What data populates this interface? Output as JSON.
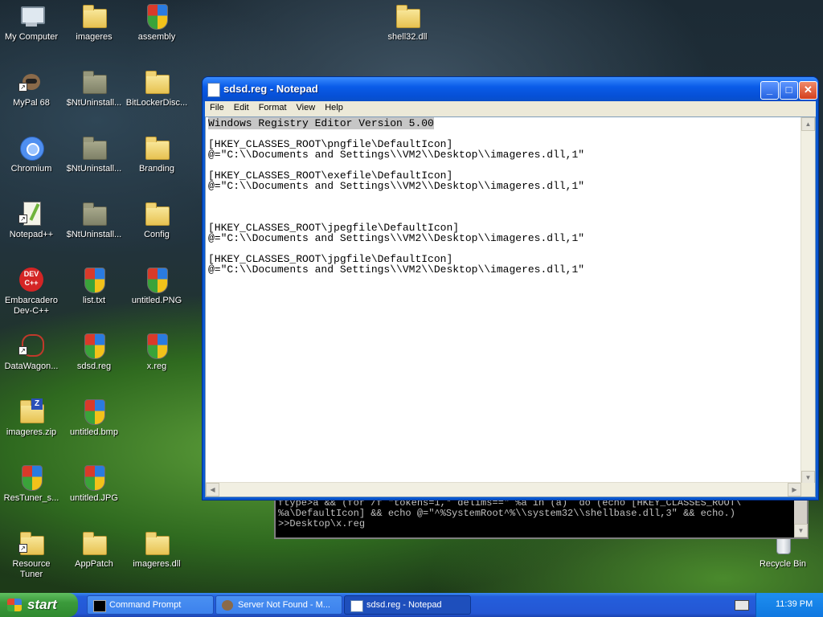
{
  "desktop": {
    "icons": [
      {
        "label": "My Computer",
        "type": "computer"
      },
      {
        "label": "imageres",
        "type": "folder"
      },
      {
        "label": "assembly",
        "type": "shield"
      },
      {
        "label": "shell32.dll",
        "type": "folder"
      },
      {
        "label": "MyPal 68",
        "type": "app"
      },
      {
        "label": "$NtUninstall...",
        "type": "folder-gray"
      },
      {
        "label": "BitLockerDisc...",
        "type": "folder"
      },
      {
        "label": "Chromium",
        "type": "app"
      },
      {
        "label": "$NtUninstall...",
        "type": "folder-gray"
      },
      {
        "label": "Branding",
        "type": "folder"
      },
      {
        "label": "Notepad++",
        "type": "app"
      },
      {
        "label": "$NtUninstall...",
        "type": "folder-gray"
      },
      {
        "label": "Config",
        "type": "folder"
      },
      {
        "label": "Embarcadero Dev-C++",
        "type": "app"
      },
      {
        "label": "list.txt",
        "type": "shield"
      },
      {
        "label": "untitled.PNG",
        "type": "shield"
      },
      {
        "label": "DataWagon...",
        "type": "app"
      },
      {
        "label": "sdsd.reg",
        "type": "shield"
      },
      {
        "label": "x.reg",
        "type": "shield"
      },
      {
        "label": "imageres.zip",
        "type": "zip"
      },
      {
        "label": "untitled.bmp",
        "type": "shield"
      },
      {
        "label": "ResTuner_s...",
        "type": "shield"
      },
      {
        "label": "untitled.JPG",
        "type": "shield"
      },
      {
        "label": "Resource Tuner",
        "type": "folder"
      },
      {
        "label": "AppPatch",
        "type": "folder"
      },
      {
        "label": "imageres.dll",
        "type": "folder"
      },
      {
        "label": "Recycle Bin",
        "type": "recycle"
      }
    ]
  },
  "notepad": {
    "title": "sdsd.reg - Notepad",
    "menu": [
      "File",
      "Edit",
      "Format",
      "View",
      "Help"
    ],
    "content_selected": "Windows Registry Editor Version 5.00",
    "content_rest": "\n\n[HKEY_CLASSES_ROOT\\pngfile\\DefaultIcon]\n@=\"C:\\\\Documents and Settings\\\\VM2\\\\Desktop\\\\imageres.dll,1\"\n\n[HKEY_CLASSES_ROOT\\exefile\\DefaultIcon]\n@=\"C:\\\\Documents and Settings\\\\VM2\\\\Desktop\\\\imageres.dll,1\"\n\n\n\n[HKEY_CLASSES_ROOT\\jpegfile\\DefaultIcon]\n@=\"C:\\\\Documents and Settings\\\\VM2\\\\Desktop\\\\imageres.dll,1\"\n\n[HKEY_CLASSES_ROOT\\jpgfile\\DefaultIcon]\n@=\"C:\\\\Documents and Settings\\\\VM2\\\\Desktop\\\\imageres.dll,1\""
  },
  "cmd": {
    "lines": "ftype>a && (for /f \"tokens=1,* delims==\" %a in (a)  do (echo [HKEY_CLASSES_ROOT\\\n%a\\DefaultIcon] && echo @=\"^%SystemRoot^%\\\\system32\\\\shellbase.dll,3\" && echo.)\n>>Desktop\\x.reg"
  },
  "taskbar": {
    "start_label": "start",
    "tasks": [
      {
        "label": "Command Prompt",
        "active": false
      },
      {
        "label": "Server Not Found - M...",
        "active": false
      },
      {
        "label": "sdsd.reg - Notepad",
        "active": true
      }
    ],
    "clock": "11:39 PM"
  }
}
